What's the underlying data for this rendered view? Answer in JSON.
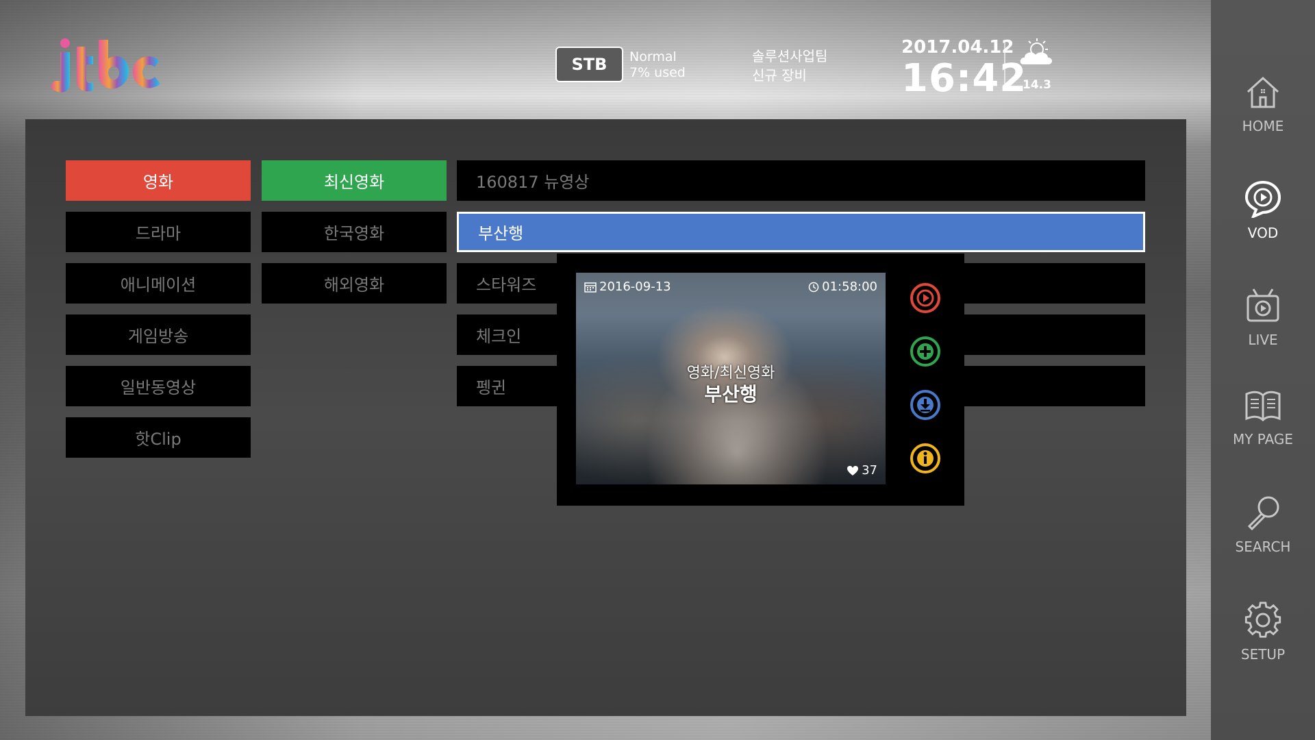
{
  "header": {
    "logo_text": "jtbc",
    "stb_label": "STB",
    "stb_status": "Normal",
    "stb_usage": "7% used",
    "team_line1": "솔루션사업팀",
    "team_line2": "신규 장비",
    "date": "2017.04.12",
    "time": "16:42",
    "weather_icon": "cloud-sun-icon",
    "temperature": "14.3"
  },
  "categories": [
    {
      "label": "영화"
    },
    {
      "label": "드라마"
    },
    {
      "label": "애니메이션"
    },
    {
      "label": "게임방송"
    },
    {
      "label": "일반동영상"
    },
    {
      "label": "핫Clip"
    }
  ],
  "subcategories": [
    {
      "label": "최신영화"
    },
    {
      "label": "한국영화"
    },
    {
      "label": "해외영화"
    }
  ],
  "content_list": [
    {
      "label": "160817 뉴영상"
    },
    {
      "label": "부산행"
    },
    {
      "label": "스타워즈"
    },
    {
      "label": "체크인"
    },
    {
      "label": "펭귄"
    }
  ],
  "popup": {
    "date": "2016-09-13",
    "duration": "01:58:00",
    "category": "영화/최신영화",
    "title": "부산행",
    "likes": "37",
    "actions": [
      "play-icon",
      "add-icon",
      "download-icon",
      "info-icon"
    ]
  },
  "sidebar": {
    "items": [
      {
        "label": "HOME",
        "icon": "home-icon"
      },
      {
        "label": "VOD",
        "icon": "vod-icon"
      },
      {
        "label": "LIVE",
        "icon": "live-tv-icon"
      },
      {
        "label": "MY PAGE",
        "icon": "book-icon"
      },
      {
        "label": "SEARCH",
        "icon": "search-icon"
      },
      {
        "label": "SETUP",
        "icon": "gear-icon"
      }
    ]
  },
  "colors": {
    "category_active": "#e0483a",
    "subcategory_active": "#2fa54f",
    "list_selected": "#4a79c9",
    "play": "#e0483a",
    "add": "#2fa54f",
    "download": "#4a79c9",
    "info": "#f0b41c"
  }
}
